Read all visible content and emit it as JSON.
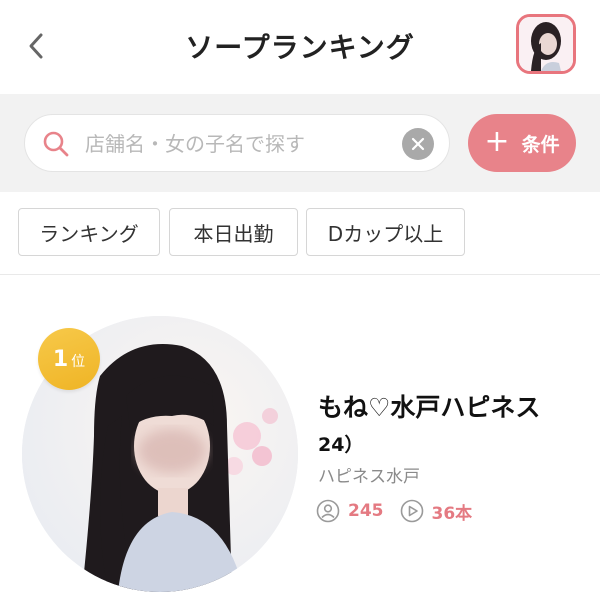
{
  "header": {
    "title": "ソープランキング",
    "back_icon": "chevron-left-icon"
  },
  "search": {
    "placeholder": "店舗名・女の子名で探す",
    "value": "",
    "filter_label": "条件",
    "accent": "#e8838a"
  },
  "chips": [
    {
      "label": "ランキング"
    },
    {
      "label": "本日出勤"
    },
    {
      "label": "Dカップ以上"
    }
  ],
  "ranking": {
    "items": [
      {
        "rank": "1",
        "rank_suffix": "位",
        "name": "もね♡水戸ハピネス",
        "age": "24）",
        "shop": "ハピネス水戸",
        "followers": "245",
        "videos": "36本"
      }
    ],
    "badge_color": "#f2bb2f",
    "stat_color": "#e47a82"
  }
}
